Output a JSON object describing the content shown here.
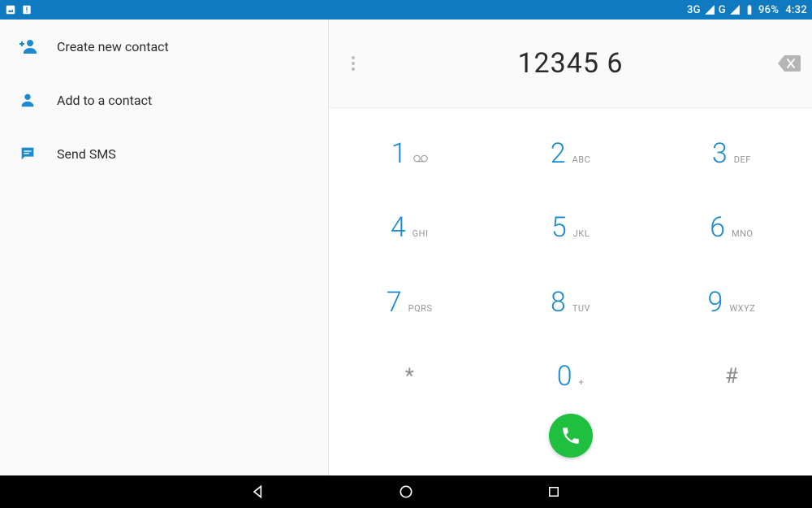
{
  "status_bar": {
    "network1": "3G",
    "network2": "G",
    "battery_percent": "96%",
    "time": "4:32"
  },
  "left_actions": [
    {
      "id": "create-new-contact",
      "label": "Create new contact",
      "icon": "person-plus"
    },
    {
      "id": "add-to-contact",
      "label": "Add to a contact",
      "icon": "person"
    },
    {
      "id": "send-sms",
      "label": "Send SMS",
      "icon": "message"
    }
  ],
  "dialer": {
    "number": "12345 6",
    "keys": [
      {
        "digit": "1",
        "letters": "",
        "extra": "voicemail"
      },
      {
        "digit": "2",
        "letters": "ABC"
      },
      {
        "digit": "3",
        "letters": "DEF"
      },
      {
        "digit": "4",
        "letters": "GHI"
      },
      {
        "digit": "5",
        "letters": "JKL"
      },
      {
        "digit": "6",
        "letters": "MNO"
      },
      {
        "digit": "7",
        "letters": "PQRS"
      },
      {
        "digit": "8",
        "letters": "TUV"
      },
      {
        "digit": "9",
        "letters": "WXYZ"
      },
      {
        "digit": "*",
        "sym": true
      },
      {
        "digit": "0",
        "letters": "+"
      },
      {
        "digit": "#",
        "sym": true
      }
    ]
  },
  "colors": {
    "accent": "#1c8ad0",
    "status_bar": "#0f7ac0",
    "call_green": "#1fbf3f"
  }
}
